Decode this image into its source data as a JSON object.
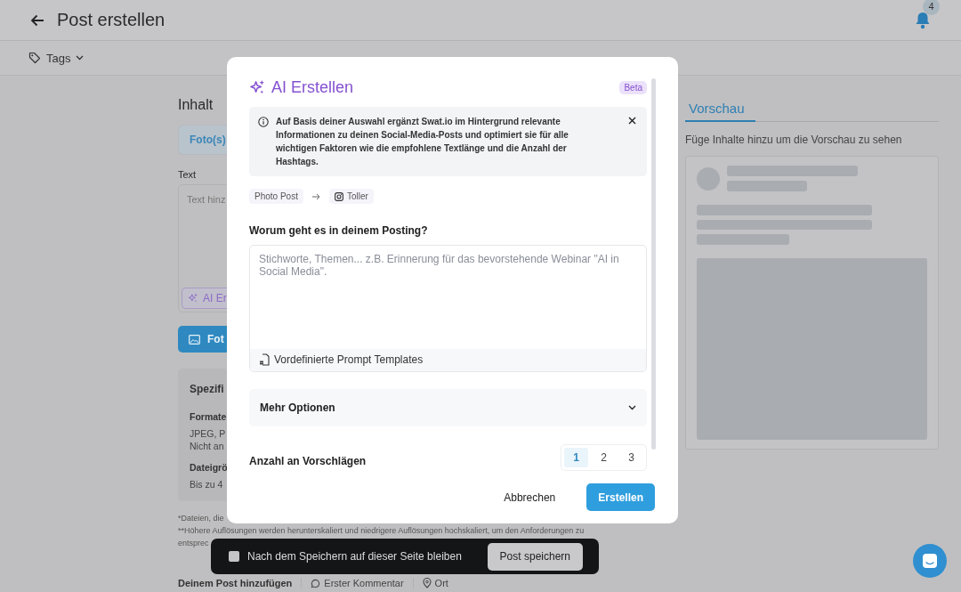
{
  "header": {
    "title": "Post erstellen",
    "notifications": "4"
  },
  "toolbar": {
    "tags": "Tags"
  },
  "editor": {
    "heading": "Inhalt",
    "tab": "Foto(s)",
    "text_label": "Text",
    "text_placeholder": "Text hinz",
    "ai_button": "AI Er",
    "photo_button": "Fot",
    "specs": {
      "title": "Spezifi",
      "formats_label": "Formate",
      "formats": [
        "JPEG, P",
        "Nicht an"
      ],
      "size_label": "Dateigrö",
      "size": "Bis zu 4"
    },
    "notes": [
      "*Dateien, die",
      "**Höhere Auflösungen werden herunterskaliert und niedrigere Auflösungen hochskaliert, um den Anforderungen zu",
      "entsprec"
    ]
  },
  "add_to_post": {
    "label": "Deinem Post hinzufügen",
    "chips": [
      {
        "label": "Erster Kommentar",
        "kind": "comment"
      },
      {
        "label": "Ort",
        "kind": "location"
      }
    ]
  },
  "preview": {
    "tab": "Vorschau",
    "hint": "Füge Inhalte hinzu um die Vorschau zu sehen"
  },
  "save_bar": {
    "checkbox": {
      "label": "Nach dem Speichern auf dieser Seite bleiben",
      "checked": false
    },
    "button": "Post speichern"
  },
  "dialog": {
    "title": "AI Erstellen",
    "badge": "Beta",
    "info": "Auf Basis deiner Auswahl ergänzt Swat.io im Hintergrund relevante Informationen zu deinen Social-Media-Posts und optimiert sie für alle wichtigen Faktoren wie die empfohlene Textlänge und die Anzahl der Hashtags.",
    "source": "Photo Post",
    "target": "Toller",
    "question": "Worum geht es in deinem Posting?",
    "prompt_placeholder": "Stichworte, Themen... z.B. Erinnerung für das bevorstehende Webinar \"AI in Social Media\".",
    "templates": "Vordefinierte Prompt Templates",
    "more_options": {
      "label": "Mehr Optionen",
      "expanded": false
    },
    "count_label": "Anzahl an Vorschlägen",
    "count_options": [
      {
        "label": "1",
        "selected": true
      },
      {
        "label": "2",
        "selected": false
      },
      {
        "label": "3",
        "selected": false
      }
    ],
    "buttons": [
      {
        "label": "Abbrechen",
        "kind": "secondary"
      },
      {
        "label": "Erstellen",
        "kind": "primary"
      }
    ]
  }
}
